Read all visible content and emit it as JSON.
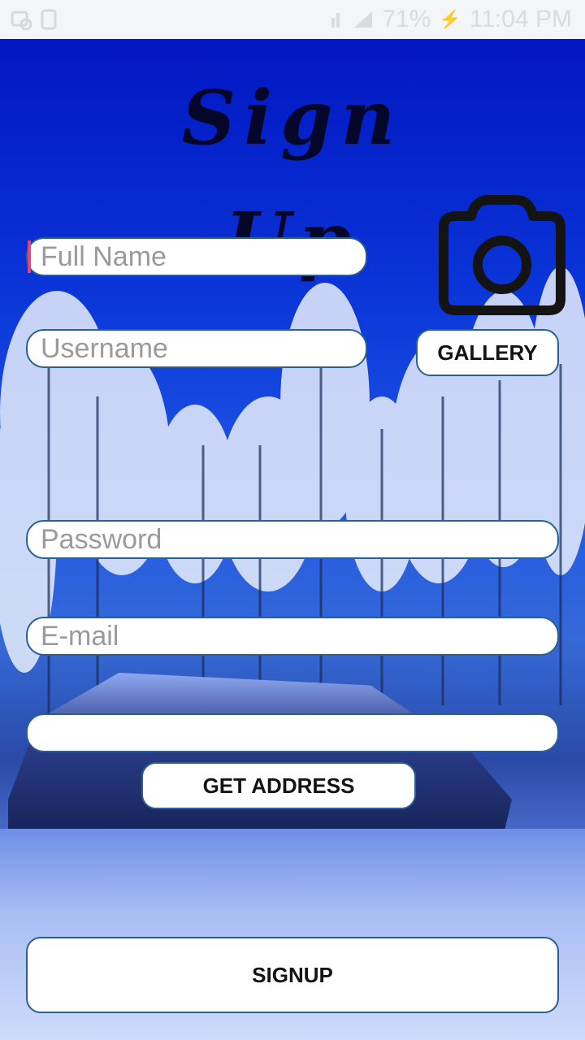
{
  "status_bar": {
    "battery": "71%",
    "time": "11:04 PM"
  },
  "title": "Sign Up",
  "form": {
    "full_name": {
      "placeholder": "Full Name",
      "value": ""
    },
    "username": {
      "placeholder": "Username",
      "value": ""
    },
    "password": {
      "placeholder": "Password",
      "value": ""
    },
    "email": {
      "placeholder": "E-mail",
      "value": ""
    },
    "address": {
      "placeholder": "",
      "value": ""
    }
  },
  "buttons": {
    "gallery": "GALLERY",
    "get_address": "GET ADDRESS",
    "signup": "SIGNUP"
  },
  "icons": {
    "camera": "camera-icon"
  },
  "colors": {
    "field_border": "#2b5f92",
    "cursor": "#e0457b",
    "sky": "#0a35d8"
  }
}
